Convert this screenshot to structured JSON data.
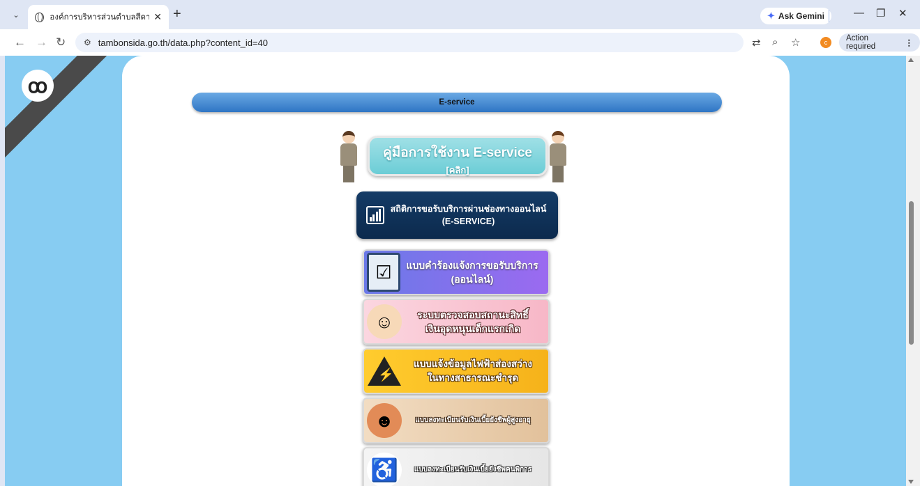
{
  "browser": {
    "tab_title": "องค์การบริหารส่วนตำบลสีดา อำเภอสีดา",
    "new_tab_symbol": "+",
    "gemini_label": "Ask Gemini",
    "url": "tambonsida.go.th/data.php?content_id=40",
    "profile_initial": "c",
    "action_label": "Action required"
  },
  "page": {
    "section_header": "E-service",
    "manual_title": "คู่มือการใช้งาน E-service",
    "manual_sub": "[คลิก]",
    "stats_line1": "สถิติการขอรับบริการผ่านช่องทางออนไลน์",
    "stats_line2": "(E-SERVICE)",
    "cards": [
      {
        "line1": "แบบคำร้องแจ้งการขอรับบริการ",
        "line2": "(ออนไลน์)",
        "icon": "form-icon"
      },
      {
        "line1": "ระบบตรวจสอบสถานะสิทธิ์",
        "line2": "เงินอุดหนุนเด็กแรกเกิด",
        "icon": "baby-icon"
      },
      {
        "line1": "แบบแจ้งข้อมูลไฟฟ้าส่องสว่าง",
        "line2": "ในทางสาธารณะชำรุด",
        "icon": "no-electricity-icon"
      },
      {
        "line1": "แบบลงทะเบียนรับเงินเบี้ยยังชีพผู้สูงอายุ",
        "line2": "",
        "icon": "elderly-icon"
      },
      {
        "line1": "แบบลงทะเบียนรับเงินเบี้ยยังชีพคนพิการ",
        "line2": "",
        "icon": "wheelchair-icon"
      }
    ]
  },
  "colors": {
    "page_bg": "#87ccf2",
    "header_bar": "#2f75c4",
    "stats_bg": "#143b66"
  }
}
